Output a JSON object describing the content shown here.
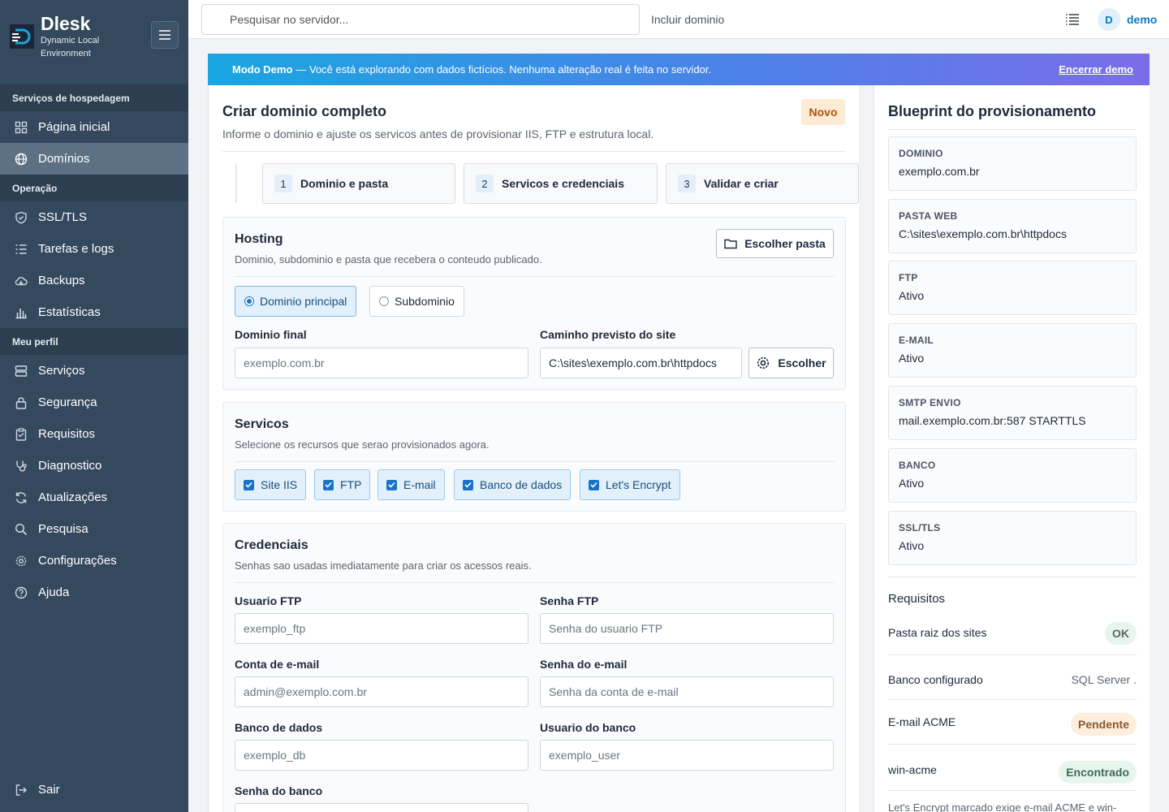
{
  "brand": {
    "name": "Dlesk",
    "subtitle_line1": "Dynamic Local",
    "subtitle_line2": "Environment"
  },
  "sidebar": {
    "sections": [
      {
        "title": "Serviços de hospedagem",
        "items": [
          {
            "label": "Página inicial",
            "icon": "dashboard-icon"
          },
          {
            "label": "Domínios",
            "icon": "globe-icon",
            "active": true
          }
        ]
      },
      {
        "title": "Operação",
        "items": [
          {
            "label": "SSL/TLS",
            "icon": "shield-icon"
          },
          {
            "label": "Tarefas e logs",
            "icon": "tasks-icon"
          },
          {
            "label": "Backups",
            "icon": "cloud-icon"
          },
          {
            "label": "Estatísticas",
            "icon": "chart-icon"
          }
        ]
      },
      {
        "title": "Meu perfil",
        "items": [
          {
            "label": "Serviços",
            "icon": "server-icon"
          },
          {
            "label": "Segurança",
            "icon": "lock-icon"
          },
          {
            "label": "Requisitos",
            "icon": "clipboard-icon"
          },
          {
            "label": "Diagnostico",
            "icon": "stethoscope-icon"
          },
          {
            "label": "Atualizações",
            "icon": "refresh-icon"
          },
          {
            "label": "Pesquisa",
            "icon": "search-icon"
          },
          {
            "label": "Configurações",
            "icon": "gear-icon"
          },
          {
            "label": "Ajuda",
            "icon": "help-icon"
          }
        ]
      }
    ],
    "logout": "Sair"
  },
  "topbar": {
    "search_placeholder": "Pesquisar no servidor...",
    "include_domain": "Incluir dominio",
    "avatar_letter": "D",
    "username": "demo"
  },
  "banner": {
    "bold": "Modo Demo",
    "text": "— Você está explorando com dados fictícios. Nenhuma alteração real é feita no servidor.",
    "end_link": "Encerrar demo"
  },
  "main": {
    "title": "Criar dominio completo",
    "badge": "Novo",
    "subtitle": "Informe o dominio e ajuste os servicos antes de provisionar IIS, FTP e estrutura local.",
    "steps": [
      {
        "num": "1",
        "label": "Dominio e pasta"
      },
      {
        "num": "2",
        "label": "Servicos e credenciais"
      },
      {
        "num": "3",
        "label": "Validar e criar"
      }
    ],
    "hosting": {
      "title": "Hosting",
      "desc": "Dominio, subdominio e pasta que recebera o conteudo publicado.",
      "choose_folder": "Escolher pasta",
      "radio_main": "Dominio principal",
      "radio_sub": "Subdominio",
      "domain_label": "Dominio final",
      "domain_placeholder": "exemplo.com.br",
      "path_label": "Caminho previsto do site",
      "path_value": "C:\\sites\\exemplo.com.br\\httpdocs",
      "choose_btn": "Escolher"
    },
    "services": {
      "title": "Servicos",
      "desc": "Selecione os recursos que serao provisionados agora.",
      "items": [
        "Site IIS",
        "FTP",
        "E-mail",
        "Banco de dados",
        "Let's Encrypt"
      ]
    },
    "credentials": {
      "title": "Credenciais",
      "desc": "Senhas sao usadas imediatamente para criar os acessos reais.",
      "ftp_user_label": "Usuario FTP",
      "ftp_user_placeholder": "exemplo_ftp",
      "ftp_pass_label": "Senha FTP",
      "ftp_pass_placeholder": "Senha do usuario FTP",
      "email_label": "Conta de e-mail",
      "email_placeholder": "admin@exemplo.com.br",
      "email_pass_label": "Senha do e-mail",
      "email_pass_placeholder": "Senha da conta de e-mail",
      "db_label": "Banco de dados",
      "db_placeholder": "exemplo_db",
      "db_user_label": "Usuario do banco",
      "db_user_placeholder": "exemplo_user",
      "db_pass_label": "Senha do banco"
    }
  },
  "blueprint": {
    "title": "Blueprint do provisionamento",
    "items": [
      {
        "key": "DOMINIO",
        "value": "exemplo.com.br"
      },
      {
        "key": "PASTA WEB",
        "value": "C:\\sites\\exemplo.com.br\\httpdocs"
      },
      {
        "key": "FTP",
        "value": "Ativo"
      },
      {
        "key": "E-MAIL",
        "value": "Ativo"
      },
      {
        "key": "SMTP ENVIO",
        "value": "mail.exemplo.com.br:587 STARTTLS"
      },
      {
        "key": "BANCO",
        "value": "Ativo"
      },
      {
        "key": "SSL/TLS",
        "value": "Ativo"
      }
    ],
    "requirements_title": "Requisitos",
    "requirements": [
      {
        "name": "Pasta raiz dos sites",
        "value": "OK",
        "status": "ok"
      },
      {
        "name": "Banco configurado",
        "value": "SQL Server .",
        "status": "text"
      },
      {
        "name": "E-mail ACME",
        "value": "Pendente",
        "status": "pend"
      },
      {
        "name": "win-acme",
        "value": "Encontrado",
        "status": "found"
      }
    ],
    "note": "Let's Encrypt marcado exige e-mail ACME e win-"
  },
  "colors": {
    "sidebar": "#34495e",
    "sidebar_section": "#2c3e50",
    "accent": "#1a73c8",
    "banner_start": "#1aa6e0",
    "banner_end": "#7a6de8"
  }
}
